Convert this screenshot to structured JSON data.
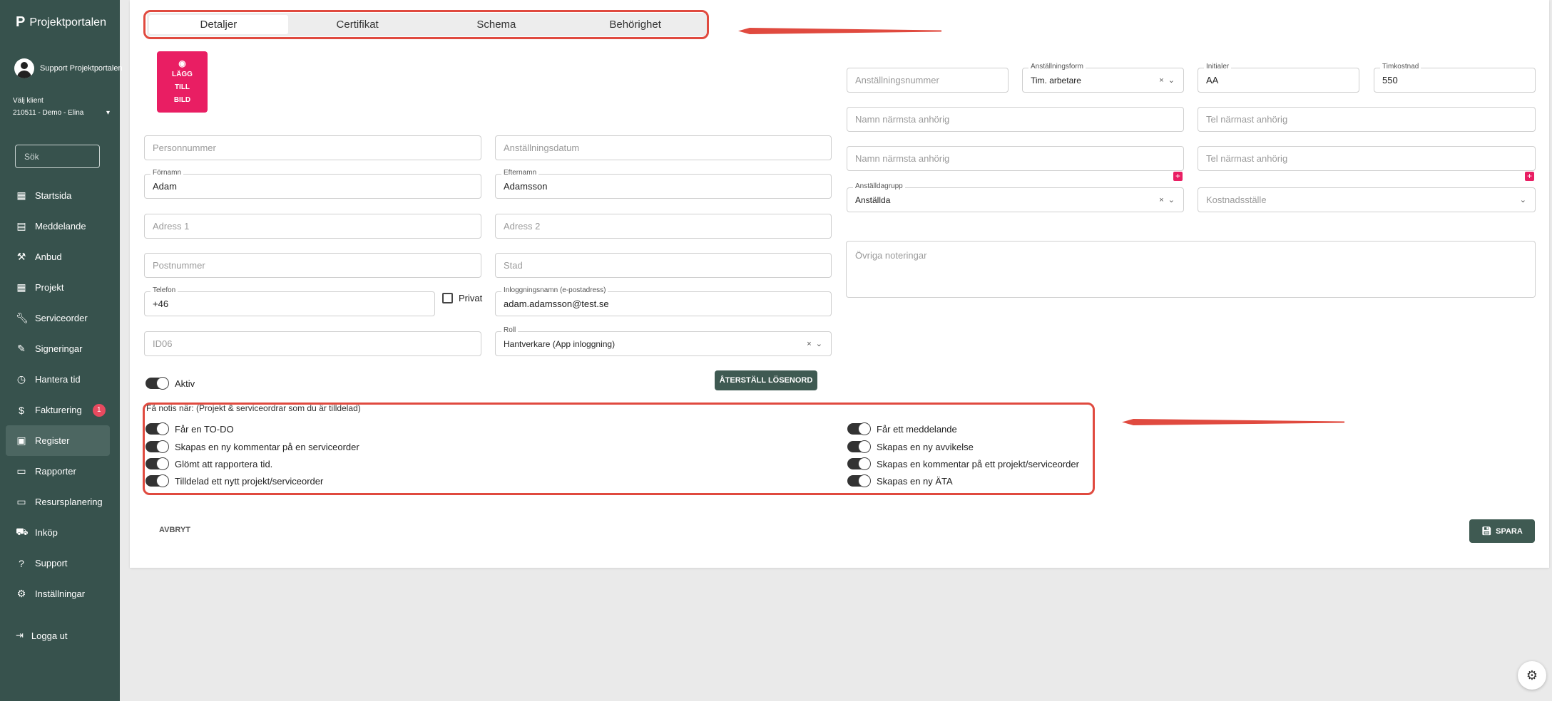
{
  "app": {
    "name": "Projektportalen",
    "logo_letter": "P"
  },
  "user": {
    "name": "Support Projektportalen"
  },
  "client": {
    "label": "Välj klient",
    "value": "210511 - Demo - Elina"
  },
  "search": {
    "placeholder": "Sök"
  },
  "nav": [
    {
      "label": "Startsida",
      "icon": "dashboard-icon"
    },
    {
      "label": "Meddelande",
      "icon": "message-icon"
    },
    {
      "label": "Anbud",
      "icon": "gavel-icon"
    },
    {
      "label": "Projekt",
      "icon": "grid-icon"
    },
    {
      "label": "Serviceorder",
      "icon": "wrench-icon"
    },
    {
      "label": "Signeringar",
      "icon": "signature-icon"
    },
    {
      "label": "Hantera tid",
      "icon": "clock-icon"
    },
    {
      "label": "Fakturering",
      "icon": "dollar-icon",
      "badge": "1"
    },
    {
      "label": "Register",
      "icon": "register-icon",
      "active": true
    },
    {
      "label": "Rapporter",
      "icon": "calendar-icon"
    },
    {
      "label": "Resursplanering",
      "icon": "calendar-icon"
    },
    {
      "label": "Inköp",
      "icon": "cart-icon"
    },
    {
      "label": "Support",
      "icon": "help-icon"
    },
    {
      "label": "Inställningar",
      "icon": "gear-icon"
    }
  ],
  "logout": {
    "label": "Logga ut"
  },
  "tabs": [
    "Detaljer",
    "Certifikat",
    "Schema",
    "Behörighet"
  ],
  "add_picture": {
    "line1": "LÄGG",
    "line2": "TILL",
    "line3": "BILD"
  },
  "form": {
    "personnummer": {
      "placeholder": "Personnummer"
    },
    "anstallningsdatum": {
      "placeholder": "Anställningsdatum"
    },
    "fornamn": {
      "label": "Förnamn",
      "value": "Adam"
    },
    "efternamn": {
      "label": "Efternamn",
      "value": "Adamsson"
    },
    "adress1": {
      "placeholder": "Adress 1"
    },
    "adress2": {
      "placeholder": "Adress 2"
    },
    "postnummer": {
      "placeholder": "Postnummer"
    },
    "stad": {
      "placeholder": "Stad"
    },
    "telefon": {
      "label": "Telefon",
      "value": "+46"
    },
    "privat": {
      "label": "Privat"
    },
    "inloggningsnamn": {
      "label": "Inloggningsnamn (e-postadress)",
      "value": "adam.adamsson@test.se"
    },
    "id06": {
      "placeholder": "ID06"
    },
    "roll": {
      "label": "Roll",
      "value": "Hantverkare (App inloggning)"
    },
    "anstallningsnummer": {
      "placeholder": "Anställningsnummer"
    },
    "anstallningsform": {
      "label": "Anställningsform",
      "value": "Tim. arbetare"
    },
    "initialer": {
      "label": "Initialer",
      "value": "AA"
    },
    "timkostnad": {
      "label": "Timkostnad",
      "value": "550"
    },
    "namn_anhorig_1": {
      "placeholder": "Namn närmsta anhörig"
    },
    "tel_anhorig_1": {
      "placeholder": "Tel närmast anhörig"
    },
    "namn_anhorig_2": {
      "placeholder": "Namn närmsta anhörig"
    },
    "tel_anhorig_2": {
      "placeholder": "Tel närmast anhörig"
    },
    "anstalldagrupp": {
      "label": "Anställdagrupp",
      "value": "Anställda"
    },
    "kostnadsstalle": {
      "placeholder": "Kostnadsställe"
    },
    "ovriga": {
      "placeholder": "Övriga noteringar"
    }
  },
  "aktiv": {
    "label": "Aktiv"
  },
  "reset_password": {
    "label": "ÅTERSTÄLL LÖSENORD"
  },
  "notifications": {
    "title": "Få notis när: (Projekt & serviceordrar som du är tilldelad)",
    "left": [
      "Får en TO-DO",
      "Skapas en ny kommentar på en serviceorder",
      "Glömt att rapportera tid.",
      "Tilldelad ett nytt projekt/serviceorder"
    ],
    "right": [
      "Får ett meddelande",
      "Skapas en ny avvikelse",
      "Skapas en kommentar på ett projekt/serviceorder",
      "Skapas en ny ÄTA"
    ]
  },
  "actions": {
    "cancel": "AVBRYT",
    "save": "SPARA"
  },
  "colors": {
    "sidebar": "#37524d",
    "accent": "#e91e63",
    "annotation": "#e04a3f",
    "button": "#3f5a52"
  }
}
